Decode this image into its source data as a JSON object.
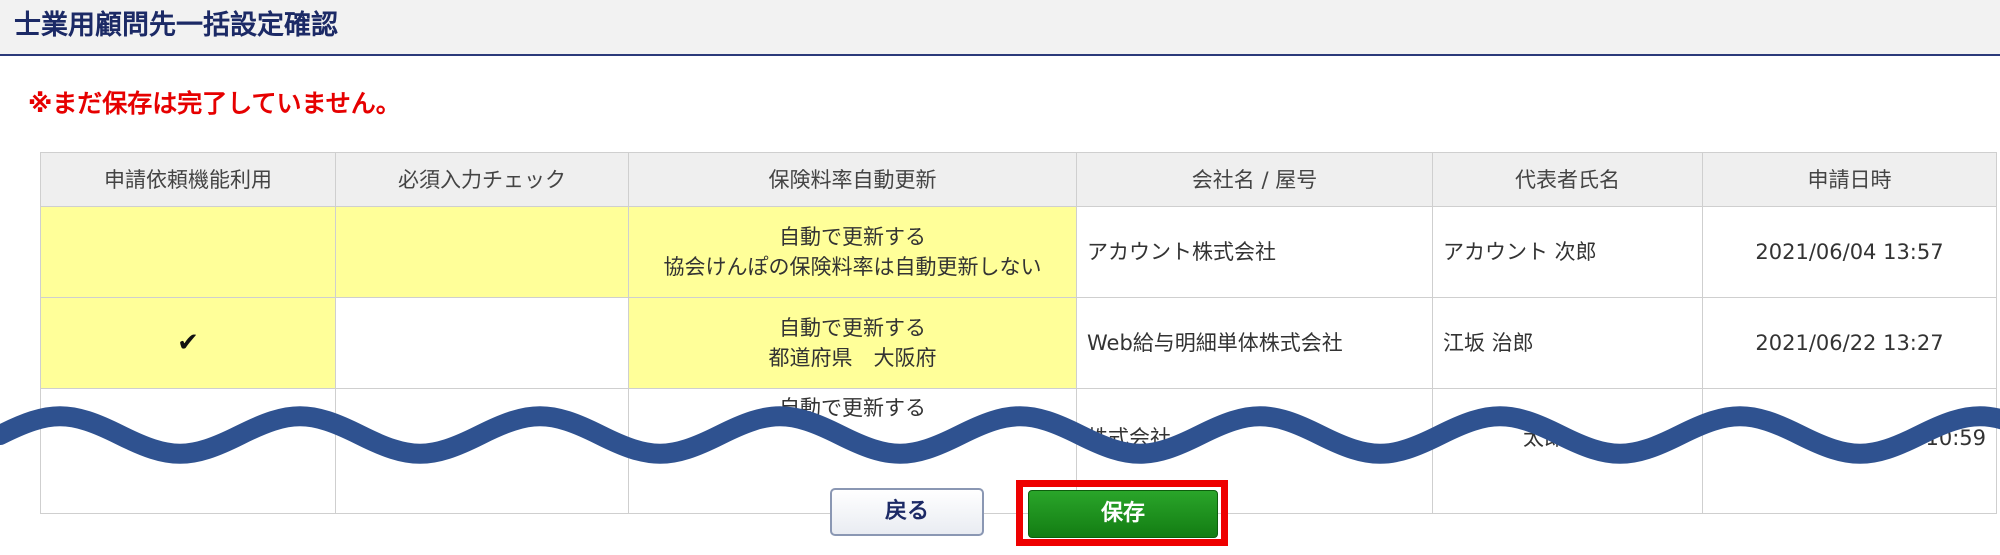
{
  "page": {
    "title": "士業用顧問先一括設定確認",
    "warning": "※まだ保存は完了していません。"
  },
  "table": {
    "columns": [
      "申請依頼機能利用",
      "必須入力チェック",
      "保険料率自動更新",
      "会社名 / 屋号",
      "代表者氏名",
      "申請日時"
    ],
    "rows": [
      {
        "request_feature": "",
        "required_check": "",
        "insurance_line1": "自動で更新する",
        "insurance_line2": "協会けんぽの保険料率は自動更新しない",
        "company": "アカウント株式会社",
        "representative": "アカウント 次郎",
        "datetime": "2021/06/04 13:57"
      },
      {
        "request_feature": "✔",
        "required_check": "",
        "insurance_line1": "自動で更新する",
        "insurance_line2": "都道府県　大阪府",
        "company": "Web給与明細単体株式会社",
        "representative": "江坂 治郎",
        "datetime": "2021/06/22 13:27"
      },
      {
        "request_feature": "",
        "required_check": "",
        "insurance_line1": "自動で更新する",
        "insurance_line2": "",
        "company": "株式会社",
        "representative": "太郎",
        "datetime": "10:59"
      }
    ]
  },
  "buttons": {
    "back": "戻る",
    "save": "保存"
  },
  "colors": {
    "title": "#1c2a66",
    "warning": "#e60000",
    "highlight_cell": "#ffff99",
    "save_button": "#1a8f1a",
    "focus_frame": "#ee0000",
    "wave": "#2f5290"
  }
}
